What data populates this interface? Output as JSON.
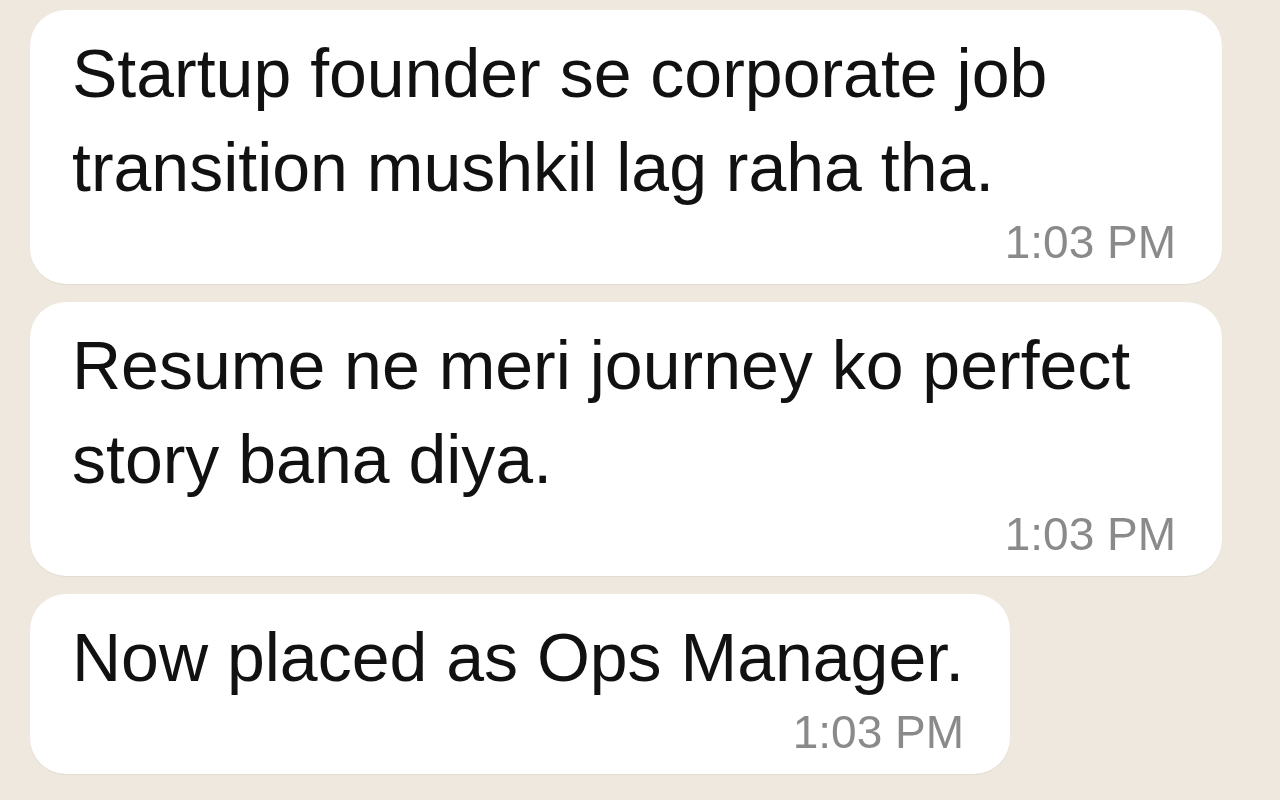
{
  "messages": [
    {
      "text": "Startup founder se corporate job transition mushkil lag raha tha.",
      "time": "1:03 PM"
    },
    {
      "text": "Resume ne meri journey ko perfect story bana diya.",
      "time": "1:03 PM"
    },
    {
      "text": "Now placed as Ops Manager.",
      "time": "1:03 PM"
    }
  ]
}
